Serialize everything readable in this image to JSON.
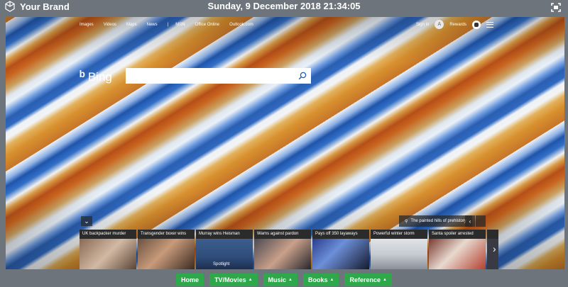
{
  "app": {
    "brand": "Your Brand",
    "datetime": "Sunday, 9 December 2018 21:34:05"
  },
  "bing": {
    "nav": [
      "Images",
      "Videos",
      "Maps",
      "News",
      "|",
      "MSN",
      "Office Online",
      "Outlook.com"
    ],
    "signin": "Sign in",
    "avatar_letter": "A",
    "rewards": "Rewards",
    "logo": "Bing",
    "search_placeholder": "",
    "credit": "The painted hills of prehistory",
    "news": [
      {
        "headline": "UK backpacker murder",
        "thumb": "#8a6a55"
      },
      {
        "headline": "Transgender boxer wins",
        "thumb": "#6b5240"
      },
      {
        "headline": "Murray wins Heisman",
        "thumb": "#2f4d7a",
        "tag": "Spotlight"
      },
      {
        "headline": "Warns against pardon",
        "thumb": "#4c4a52"
      },
      {
        "headline": "Pays off 350 layaways",
        "thumb": "#2b3e8f"
      },
      {
        "headline": "Powerful winter storm",
        "thumb": "#c7ccd2"
      },
      {
        "headline": "Santa spoiler arrested",
        "thumb": "#7b3a30"
      },
      {
        "headline": "",
        "thumb": "#3a3a44"
      }
    ]
  },
  "footer": {
    "buttons": [
      {
        "label": "Home",
        "caret": false
      },
      {
        "label": "TV/Movies",
        "caret": true
      },
      {
        "label": "Music",
        "caret": true
      },
      {
        "label": "Books",
        "caret": true
      },
      {
        "label": "Reference",
        "caret": true
      }
    ]
  }
}
